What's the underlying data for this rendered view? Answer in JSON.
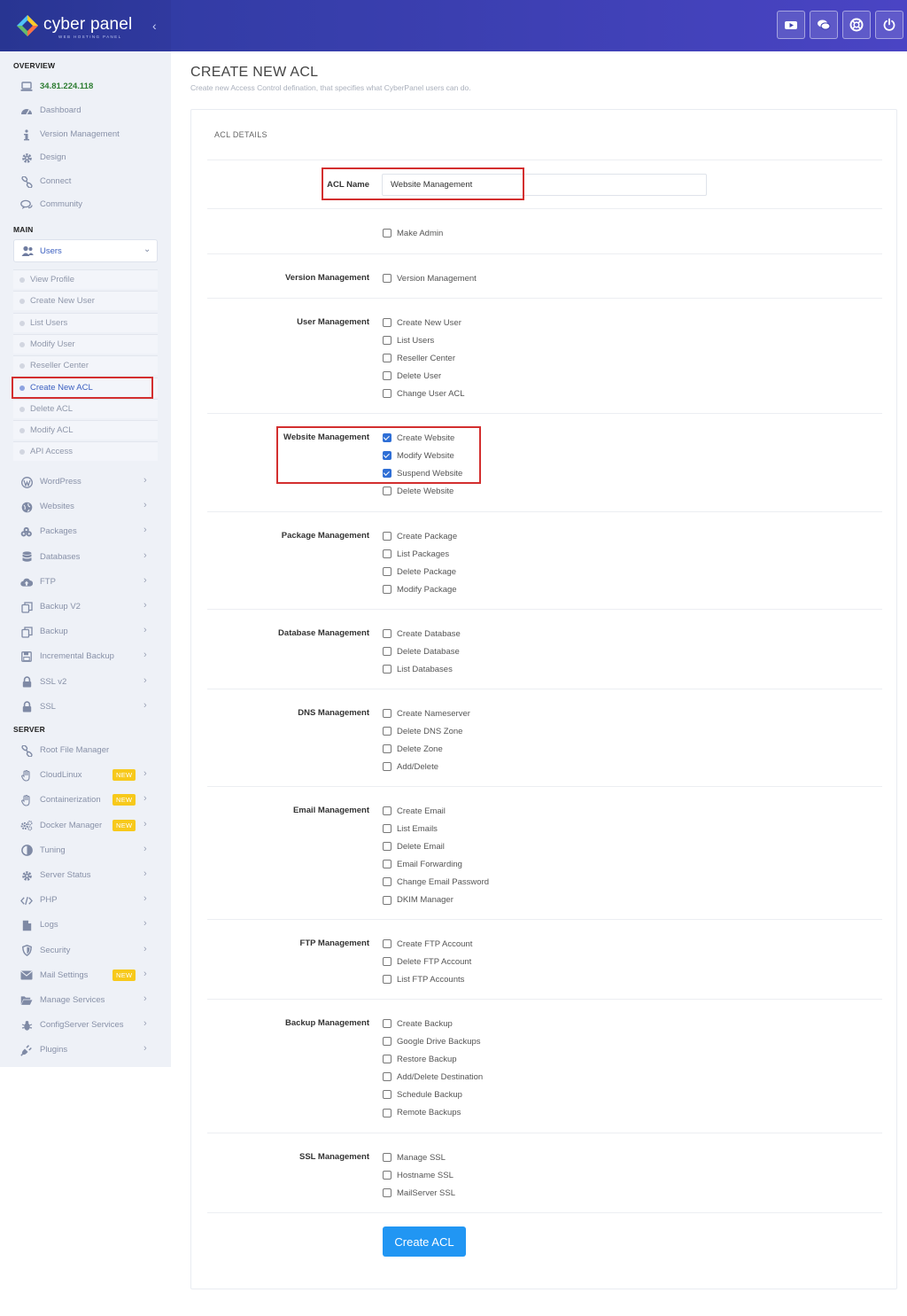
{
  "brand": {
    "name": "cyber panel",
    "tagline": "WEB HOSTING PANEL",
    "collapse_glyph": "‹",
    "logo_colors": [
      "#4fc3f7",
      "#ff7043",
      "#66bb6a",
      "#ffca28"
    ]
  },
  "header": {
    "buttons": [
      {
        "name": "youtube-icon"
      },
      {
        "name": "chat-icon"
      },
      {
        "name": "support-icon"
      },
      {
        "name": "power-icon"
      }
    ]
  },
  "sidebar": {
    "sections": {
      "overview": "OVERVIEW",
      "main": "MAIN",
      "server": "SERVER"
    },
    "overview_items": [
      {
        "label": "34.81.224.118",
        "icon": "laptop-icon"
      },
      {
        "label": "Dashboard",
        "icon": "dashboard-icon"
      },
      {
        "label": "Version Management",
        "icon": "info-icon"
      },
      {
        "label": "Design",
        "icon": "cog-icon"
      },
      {
        "label": "Connect",
        "icon": "link-icon"
      },
      {
        "label": "Community",
        "icon": "comments-icon"
      }
    ],
    "users_menu": {
      "label": "Users",
      "items": [
        {
          "label": "View Profile"
        },
        {
          "label": "Create New User"
        },
        {
          "label": "List Users"
        },
        {
          "label": "Modify User"
        },
        {
          "label": "Reseller Center"
        },
        {
          "label": "Create New ACL"
        },
        {
          "label": "Delete ACL"
        },
        {
          "label": "Modify ACL"
        },
        {
          "label": "API Access"
        }
      ]
    },
    "main_items": [
      {
        "label": "WordPress",
        "icon": "wordpress-icon"
      },
      {
        "label": "Websites",
        "icon": "globe-icon"
      },
      {
        "label": "Packages",
        "icon": "packages-icon"
      },
      {
        "label": "Databases",
        "icon": "database-icon"
      },
      {
        "label": "FTP",
        "icon": "cloud-upload-icon"
      },
      {
        "label": "Backup V2",
        "icon": "copy-icon"
      },
      {
        "label": "Backup",
        "icon": "copy-icon"
      },
      {
        "label": "Incremental Backup",
        "icon": "save-icon"
      },
      {
        "label": "SSL v2",
        "icon": "lock-icon"
      },
      {
        "label": "SSL",
        "icon": "lock-icon"
      }
    ],
    "server_items": [
      {
        "label": "Root File Manager",
        "icon": "link-icon"
      },
      {
        "label": "CloudLinux",
        "icon": "hand-icon",
        "badge": "NEW"
      },
      {
        "label": "Containerization",
        "icon": "hand-icon",
        "badge": "NEW"
      },
      {
        "label": "Docker Manager",
        "icon": "cogs-icon",
        "badge": "NEW"
      },
      {
        "label": "Tuning",
        "icon": "half-circle-icon"
      },
      {
        "label": "Server Status",
        "icon": "cog-icon"
      },
      {
        "label": "PHP",
        "icon": "code-icon"
      },
      {
        "label": "Logs",
        "icon": "file-icon"
      },
      {
        "label": "Security",
        "icon": "shield-icon"
      },
      {
        "label": "Mail Settings",
        "icon": "envelope-icon",
        "badge": "NEW"
      },
      {
        "label": "Manage Services",
        "icon": "folder-open-icon"
      },
      {
        "label": "ConfigServer Services",
        "icon": "bug-icon"
      },
      {
        "label": "Plugins",
        "icon": "plug-icon"
      }
    ]
  },
  "page": {
    "title": "CREATE NEW ACL",
    "subtitle": "Create new Access Control defination, that specifies what CyberPanel users can do.",
    "card_header": "ACL DETAILS",
    "acl_name_label": "ACL Name",
    "acl_name_value": "Website Management",
    "make_admin": {
      "label": "Make Admin",
      "checked": false
    },
    "groups": [
      {
        "label": "Version Management",
        "options": [
          {
            "label": "Version Management",
            "checked": false
          }
        ]
      },
      {
        "label": "User Management",
        "options": [
          {
            "label": "Create New User",
            "checked": false
          },
          {
            "label": "List Users",
            "checked": false
          },
          {
            "label": "Reseller Center",
            "checked": false
          },
          {
            "label": "Delete User",
            "checked": false
          },
          {
            "label": "Change User ACL",
            "checked": false
          }
        ]
      },
      {
        "label": "Website Management",
        "options": [
          {
            "label": "Create Website",
            "checked": true
          },
          {
            "label": "Modify Website",
            "checked": true
          },
          {
            "label": "Suspend Website",
            "checked": true
          },
          {
            "label": "Delete Website",
            "checked": false
          }
        ]
      },
      {
        "label": "Package Management",
        "options": [
          {
            "label": "Create Package",
            "checked": false
          },
          {
            "label": "List Packages",
            "checked": false
          },
          {
            "label": "Delete Package",
            "checked": false
          },
          {
            "label": "Modify Package",
            "checked": false
          }
        ]
      },
      {
        "label": "Database Management",
        "options": [
          {
            "label": "Create Database",
            "checked": false
          },
          {
            "label": "Delete Database",
            "checked": false
          },
          {
            "label": "List Databases",
            "checked": false
          }
        ]
      },
      {
        "label": "DNS Management",
        "options": [
          {
            "label": "Create Nameserver",
            "checked": false
          },
          {
            "label": "Delete DNS Zone",
            "checked": false
          },
          {
            "label": "Delete Zone",
            "checked": false
          },
          {
            "label": "Add/Delete",
            "checked": false
          }
        ]
      },
      {
        "label": "Email Management",
        "options": [
          {
            "label": "Create Email",
            "checked": false
          },
          {
            "label": "List Emails",
            "checked": false
          },
          {
            "label": "Delete Email",
            "checked": false
          },
          {
            "label": "Email Forwarding",
            "checked": false
          },
          {
            "label": "Change Email Password",
            "checked": false
          },
          {
            "label": "DKIM Manager",
            "checked": false
          }
        ]
      },
      {
        "label": "FTP Management",
        "options": [
          {
            "label": "Create FTP Account",
            "checked": false
          },
          {
            "label": "Delete FTP Account",
            "checked": false
          },
          {
            "label": "List FTP Accounts",
            "checked": false
          }
        ]
      },
      {
        "label": "Backup Management",
        "options": [
          {
            "label": "Create Backup",
            "checked": false
          },
          {
            "label": "Google Drive Backups",
            "checked": false
          },
          {
            "label": "Restore Backup",
            "checked": false
          },
          {
            "label": "Add/Delete Destination",
            "checked": false
          },
          {
            "label": "Schedule Backup",
            "checked": false
          },
          {
            "label": "Remote Backups",
            "checked": false
          }
        ]
      },
      {
        "label": "SSL Management",
        "options": [
          {
            "label": "Manage SSL",
            "checked": false
          },
          {
            "label": "Hostname SSL",
            "checked": false
          },
          {
            "label": "MailServer SSL",
            "checked": false
          }
        ]
      }
    ],
    "submit_label": "Create ACL"
  },
  "colors": {
    "header": "#3b3fb0",
    "accent": "#2196f3",
    "highlight": "#d32f2f",
    "badge": "#f7c91b",
    "ip": "#2e7d32"
  }
}
